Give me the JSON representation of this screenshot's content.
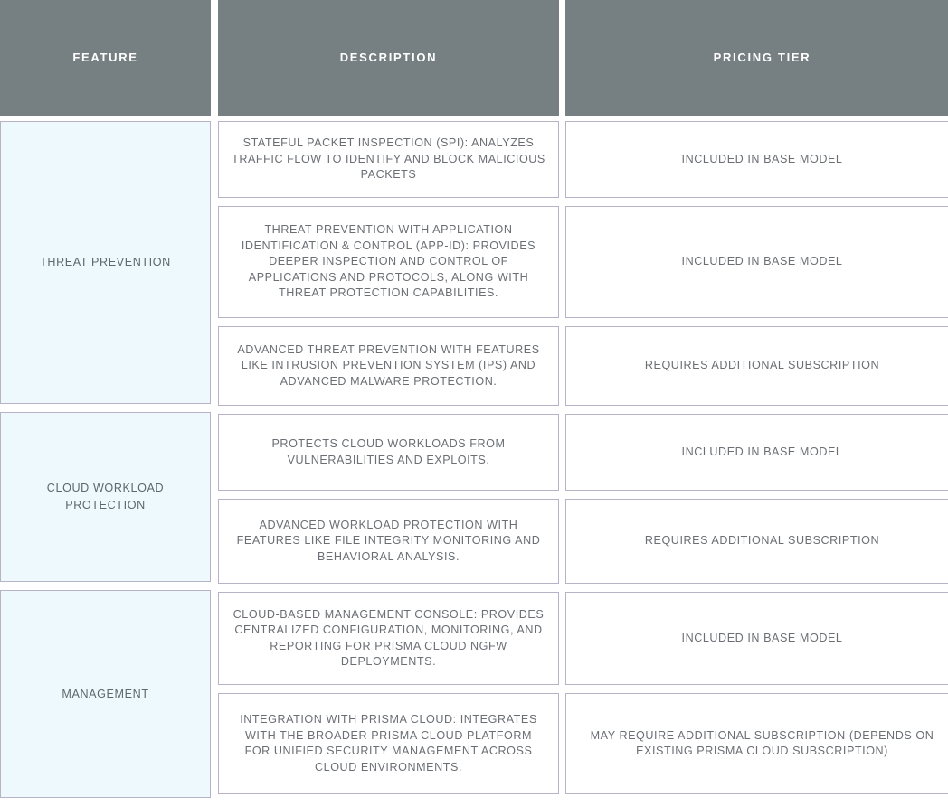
{
  "table": {
    "headers": [
      {
        "label": "Feature"
      },
      {
        "label": "Description"
      },
      {
        "label": "Pricing Tier"
      }
    ],
    "features": [
      {
        "label": "Threat Prevention"
      },
      {
        "label": "Cloud Workload Protection"
      },
      {
        "label": "Management"
      }
    ],
    "descriptions": [
      {
        "text": "Stateful Packet Inspection (SPI): Analyzes traffic flow to identify and block malicious packets"
      },
      {
        "text": "Threat Prevention with Application Identification & Control (App-ID): Provides deeper inspection and control of applications and protocols, along with threat protection capabilities."
      },
      {
        "text": "Advanced Threat Prevention with features like Intrusion Prevention System (IPS) and Advanced Malware Protection."
      },
      {
        "text": "Protects cloud workloads from vulnerabilities and exploits."
      },
      {
        "text": "Advanced workload protection with features like file integrity monitoring and behavioral analysis."
      },
      {
        "text": "Cloud-based management console: Provides centralized configuration, monitoring, and reporting for Prisma Cloud NGFW deployments."
      },
      {
        "text": "Integration with Prisma Cloud: Integrates with the broader Prisma Cloud platform for unified security management across cloud environments."
      }
    ],
    "pricing_tiers": [
      {
        "text": "Included in base model"
      },
      {
        "text": "Included in base model"
      },
      {
        "text": "Requires additional subscription"
      },
      {
        "text": "Included in base model"
      },
      {
        "text": "Requires additional subscription"
      },
      {
        "text": "Included in base model"
      },
      {
        "text": "May require additional subscription (depends on existing Prisma Cloud subscription)"
      }
    ],
    "colors": {
      "header_background": "#767f81",
      "header_text": "#ffffff",
      "cell_border": "#b7b2c6",
      "feature_background": "#edf9fd",
      "body_text": "#6b6f74",
      "page_background": "#ffffff"
    }
  }
}
